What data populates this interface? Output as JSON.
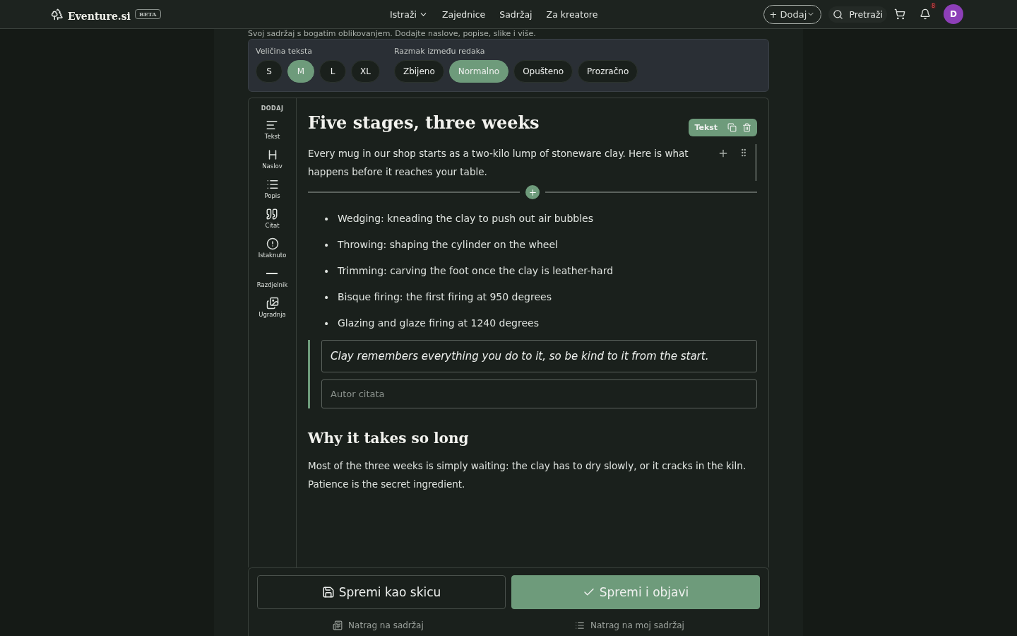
{
  "header": {
    "logo": "Eventure.si",
    "badge": "BETA",
    "nav": [
      {
        "label": "Istraži",
        "kind": "dropdown"
      },
      {
        "label": "Zajednice",
        "kind": "link"
      },
      {
        "label": "Sadržaj",
        "kind": "link"
      },
      {
        "label": "Za kreatore",
        "kind": "link"
      }
    ],
    "add_button": "+ Dodaj",
    "search": "Pretraži",
    "notification_count": "8",
    "avatar": "D"
  },
  "intro": "Svoj sadržaj s bogatim oblikovanjem. Dodajte naslove, popise, slike i više.",
  "settings": [
    {
      "label": "Veličina teksta",
      "options": [
        {
          "label": "S",
          "selected": false
        },
        {
          "label": "M",
          "selected": true
        },
        {
          "label": "L",
          "selected": false
        },
        {
          "label": "XL",
          "selected": false
        }
      ]
    },
    {
      "label": "Razmak između redaka",
      "options": [
        {
          "label": "Zbijeno",
          "selected": false
        },
        {
          "label": "Normalno",
          "selected": true
        },
        {
          "label": "Opušteno",
          "selected": false
        },
        {
          "label": "Prozračno",
          "selected": false
        }
      ]
    }
  ],
  "toolbox": {
    "title": "DODAJ",
    "items": [
      {
        "label": "Tekst",
        "kind": "text"
      },
      {
        "label": "Naslov",
        "kind": "heading"
      },
      {
        "label": "Popis",
        "kind": "list"
      },
      {
        "label": "Citat",
        "kind": "quote"
      },
      {
        "label": "Istaknuto",
        "kind": "callout"
      },
      {
        "label": "Razdjelnik",
        "kind": "divider"
      },
      {
        "label": "Ugradnja",
        "kind": "embed"
      }
    ]
  },
  "blocks": [
    {
      "kind": "heading",
      "text": "Five stages, three weeks"
    },
    {
      "kind": "paragraph",
      "text": "Every mug in our shop starts as a two-kilo lump of stoneware clay. Here is what happens before it reaches your table.",
      "selected": true,
      "toolbar_label": "Tekst"
    },
    {
      "kind": "list",
      "items": [
        "Wedging: kneading the clay to push out air bubbles",
        "Throwing: shaping the cylinder on the wheel",
        "Trimming: carving the foot once the clay is leather-hard",
        "Bisque firing: the first firing at 950 degrees",
        "Glazing and glaze firing at 1240 degrees"
      ],
      "marker": "•"
    },
    {
      "kind": "quote",
      "text": "Clay remembers everything you do to it, so be kind to it from the start.",
      "author_placeholder": "Autor citata"
    },
    {
      "kind": "heading",
      "text": "Why it takes so long"
    },
    {
      "kind": "paragraph",
      "text": "Most of the three weeks is simply waiting: the clay has to dry slowly, or it cracks in the kiln. Patience is the secret ingredient.",
      "selected": false
    }
  ],
  "footer": {
    "draft_button": "Spremi kao skicu",
    "publish_button": "Spremi i objavi",
    "links": [
      {
        "label": "Natrag na sadržaj",
        "kind": "content"
      },
      {
        "label": "Natrag na moj sadržaj",
        "kind": "mine"
      }
    ]
  }
}
